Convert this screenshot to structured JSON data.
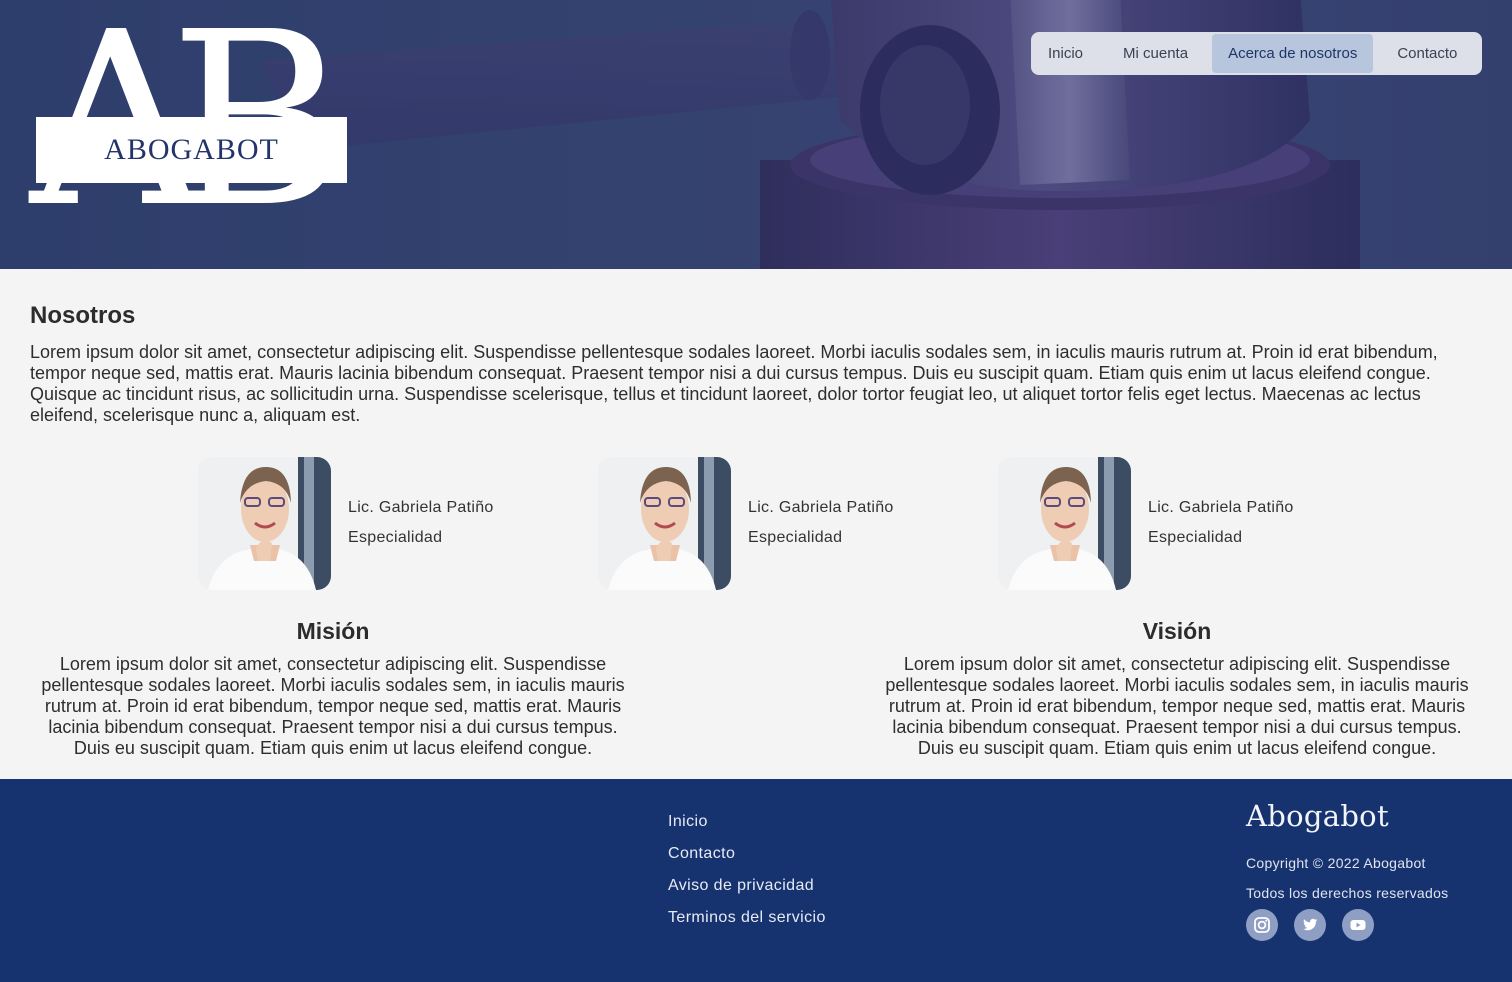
{
  "brand": {
    "logo_letters": "AB",
    "logo_word": "ABOGABOT"
  },
  "nav": {
    "items": [
      {
        "label": "Inicio",
        "active": false
      },
      {
        "label": "Mi cuenta",
        "active": false
      },
      {
        "label": "Acerca de nosotros",
        "active": true
      },
      {
        "label": "Contacto",
        "active": false
      }
    ]
  },
  "about": {
    "title": "Nosotros",
    "text": "Lorem ipsum dolor sit amet, consectetur adipiscing elit. Suspendisse pellentesque sodales laoreet. Morbi iaculis sodales sem, in iaculis mauris rutrum at. Proin id erat bibendum, tempor neque sed, mattis erat. Mauris lacinia bibendum consequat. Praesent tempor nisi a dui cursus tempus. Duis eu suscipit quam. Etiam quis enim ut lacus eleifend congue. Quisque ac tincidunt risus, ac sollicitudin urna. Suspendisse scelerisque, tellus et tincidunt laoreet, dolor tortor feugiat leo, ut aliquet tortor felis eget lectus. Maecenas ac lectus eleifend, scelerisque nunc a, aliquam est."
  },
  "team": [
    {
      "name": "Lic. Gabriela Patiño",
      "specialty": "Especialidad"
    },
    {
      "name": "Lic. Gabriela Patiño",
      "specialty": "Especialidad"
    },
    {
      "name": "Lic. Gabriela Patiño",
      "specialty": "Especialidad"
    }
  ],
  "mission": {
    "title": "Misión",
    "text": "Lorem ipsum dolor sit amet, consectetur adipiscing elit. Suspendisse pellentesque sodales laoreet. Morbi iaculis sodales sem, in iaculis mauris rutrum at. Proin id erat bibendum, tempor neque sed, mattis erat. Mauris lacinia bibendum consequat. Praesent tempor nisi a dui cursus tempus. Duis eu suscipit quam. Etiam quis enim ut lacus eleifend congue."
  },
  "vision": {
    "title": "Visión",
    "text": "Lorem ipsum dolor sit amet, consectetur adipiscing elit. Suspendisse pellentesque sodales laoreet. Morbi iaculis sodales sem, in iaculis mauris rutrum at. Proin id erat bibendum, tempor neque sed, mattis erat. Mauris lacinia bibendum consequat. Praesent tempor nisi a dui cursus tempus. Duis eu suscipit quam. Etiam quis enim ut lacus eleifend congue."
  },
  "footer": {
    "links": [
      "Inicio",
      "Contacto",
      "Aviso de privacidad",
      "Terminos del servicio"
    ],
    "brand": "Abogabot",
    "copyright": "Copyright © 2022 Abogabot",
    "rights": "Todos los derechos reservados",
    "socials": [
      "instagram-icon",
      "twitter-icon",
      "youtube-icon"
    ]
  },
  "colors": {
    "hero_overlay": "#2e3e6c",
    "nav_bg": "#dde0e9",
    "nav_active": "#b7c6dd",
    "page_bg": "#f4f4f4",
    "footer_bg": "#17336f",
    "social_bg": "#8f9fc4"
  }
}
